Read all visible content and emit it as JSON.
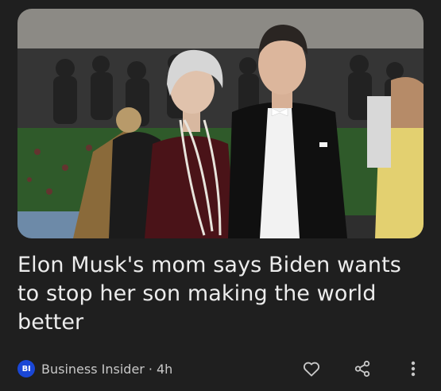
{
  "article": {
    "headline": "Elon Musk's mom says Biden wants to stop her son making the world better",
    "image_icon": "photo-two-people-red-carpet"
  },
  "publisher": {
    "logo_text": "BI",
    "name": "Business Insider",
    "separator": "·",
    "time": "4h",
    "logo_color": "#1a47d6"
  },
  "actions": {
    "like_icon": "heart-icon",
    "share_icon": "share-icon",
    "more_icon": "more-vertical-icon"
  }
}
